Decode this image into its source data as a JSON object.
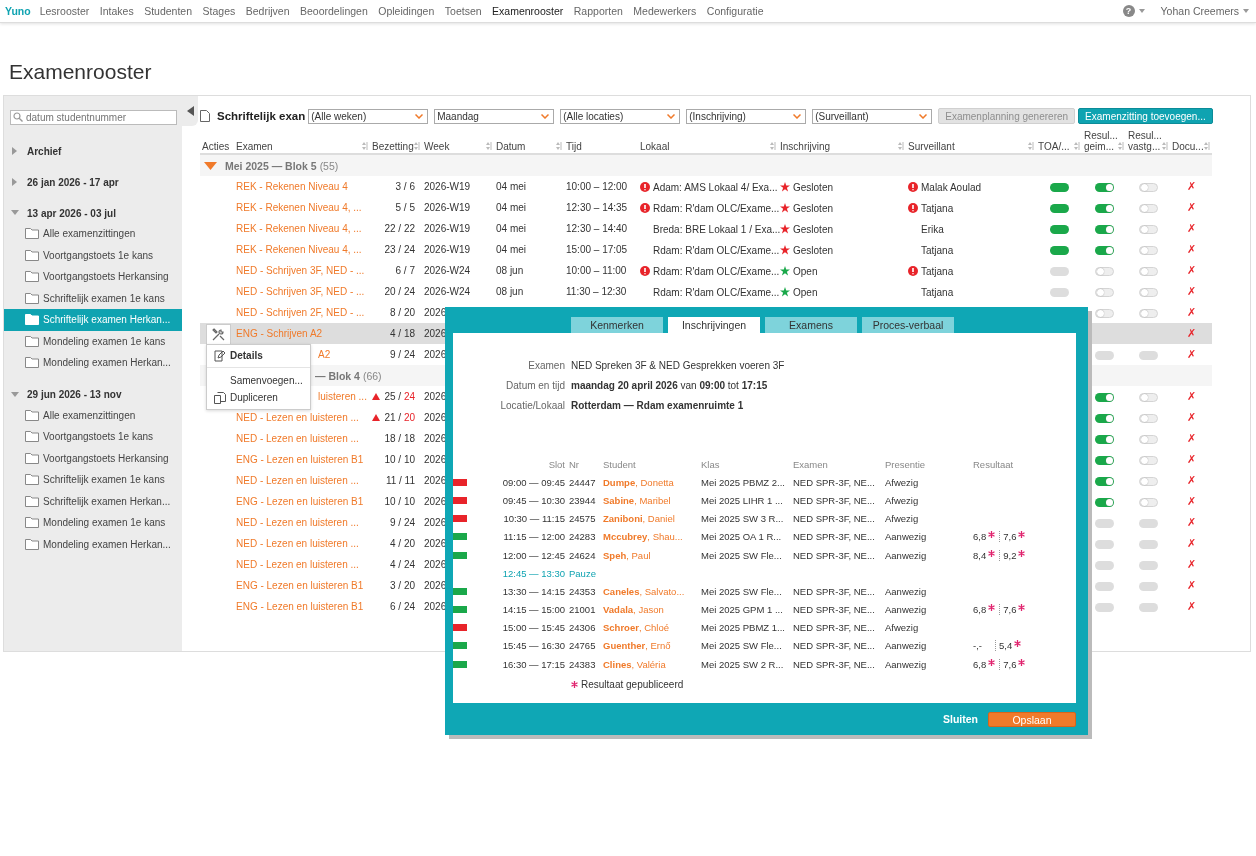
{
  "nav": {
    "logo": "Yuno",
    "items": [
      {
        "label": "Lesrooster",
        "selected": false
      },
      {
        "label": "Intakes",
        "selected": false
      },
      {
        "label": "Studenten",
        "selected": false
      },
      {
        "label": "Stages",
        "selected": false
      },
      {
        "label": "Bedrijven",
        "selected": false
      },
      {
        "label": "Beoordelingen",
        "selected": false
      },
      {
        "label": "Opleidingen",
        "selected": false
      },
      {
        "label": "Toetsen",
        "selected": false
      },
      {
        "label": "Examenrooster",
        "selected": true
      },
      {
        "label": "Rapporten",
        "selected": false
      },
      {
        "label": "Medewerkers",
        "selected": false
      },
      {
        "label": "Configuratie",
        "selected": false
      }
    ],
    "help": "?",
    "user": "Yohan Creemers"
  },
  "page_title": "Examenrooster",
  "sidebar": {
    "search_placeholder": "datum studentnummer",
    "groups": [
      {
        "label": "Archief",
        "expanded": false
      },
      {
        "label": "26 jan 2026 - 17 apr",
        "expanded": false
      },
      {
        "label": "13 apr 2026 - 03 jul",
        "expanded": true,
        "children": [
          {
            "label": "Alle examenzittingen",
            "selected": false
          },
          {
            "label": "Voortgangstoets 1e kans",
            "selected": false
          },
          {
            "label": "Voortgangstoets Herkansing",
            "selected": false
          },
          {
            "label": "Schriftelijk examen 1e kans",
            "selected": false
          },
          {
            "label": "Schriftelijk examen Herkan...",
            "selected": true
          },
          {
            "label": "Mondeling examen 1e kans",
            "selected": false
          },
          {
            "label": "Mondeling examen Herkan...",
            "selected": false
          }
        ]
      },
      {
        "label": "29 jun 2026 - 13 nov",
        "expanded": true,
        "children": [
          {
            "label": "Alle examenzittingen",
            "selected": false
          },
          {
            "label": "Voortgangstoets 1e kans",
            "selected": false
          },
          {
            "label": "Voortgangstoets Herkansing",
            "selected": false
          },
          {
            "label": "Schriftelijk examen 1e kans",
            "selected": false
          },
          {
            "label": "Schriftelijk examen Herkan...",
            "selected": false
          },
          {
            "label": "Mondeling examen 1e kans",
            "selected": false
          },
          {
            "label": "Mondeling examen Herkan...",
            "selected": false
          }
        ]
      }
    ]
  },
  "toolbar": {
    "title": "Schriftelijk exan",
    "selects": [
      {
        "value": "(Alle weken)"
      },
      {
        "value": "Maandag"
      },
      {
        "value": "(Alle locaties)"
      },
      {
        "value": "(Inschrijving)"
      },
      {
        "value": "(Surveillant)"
      }
    ],
    "buttons": [
      {
        "label": "Examenplanning genereren",
        "disabled": true
      },
      {
        "label": "Examenzitting toevoegen...",
        "disabled": false
      }
    ]
  },
  "table": {
    "columns": [
      {
        "label": "Acties",
        "sortable": false
      },
      {
        "label": "Examen",
        "sortable": true
      },
      {
        "label": "Bezetting",
        "sortable": true
      },
      {
        "label": "Week",
        "sortable": true
      },
      {
        "label": "Datum",
        "sortable": true
      },
      {
        "label": "Tijd",
        "sortable": false
      },
      {
        "label": "Lokaal",
        "sortable": true
      },
      {
        "label": "Inschrijving",
        "sortable": true
      },
      {
        "label": "Surveillant",
        "sortable": true
      },
      {
        "label": "TOA/...",
        "sortable": true
      },
      {
        "label": "geim...",
        "above": "Resul...",
        "sortable": true
      },
      {
        "label": "vastg...",
        "above": "Resul...",
        "sortable": true
      },
      {
        "label": "Docu...",
        "sortable": true
      }
    ],
    "groups": [
      {
        "label": "Mei 2025 — Blok 5",
        "count": "(55)",
        "expanded": true,
        "covered": false,
        "rows": [
          {
            "exam": "REK - Rekenen Niveau 4",
            "covered": false,
            "selected": false,
            "occupied": "3 /",
            "capacity": "6",
            "overbooked": false,
            "week": "2026-W19",
            "date": "04 mei",
            "time": "10:00 – 12:00",
            "room": "Adam: AMS Lokaal 4/ Exa...",
            "room_warning": true,
            "enrollment": "Gesloten",
            "enrollment_open": false,
            "supervisor": "Malak Aoulad",
            "supervisor_warning": true,
            "toa": true,
            "imported": true,
            "imported_disabled": false,
            "fixed": false,
            "fixed_disabled": false,
            "doc": "✗"
          },
          {
            "exam": "REK - Rekenen Niveau 4, ...",
            "covered": false,
            "selected": false,
            "occupied": "5 /",
            "capacity": "5",
            "overbooked": false,
            "week": "2026-W19",
            "date": "04 mei",
            "time": "12:30 – 14:35",
            "room": "Rdam: R'dam OLC/Exame...",
            "room_warning": true,
            "enrollment": "Gesloten",
            "enrollment_open": false,
            "supervisor": "Tatjana",
            "supervisor_warning": true,
            "toa": true,
            "imported": true,
            "imported_disabled": false,
            "fixed": false,
            "fixed_disabled": false,
            "doc": "✗"
          },
          {
            "exam": "REK - Rekenen Niveau 4, ...",
            "covered": false,
            "selected": false,
            "occupied": "22 /",
            "capacity": "22",
            "overbooked": false,
            "week": "2026-W19",
            "date": "04 mei",
            "time": "12:30 – 14:40",
            "room": "Breda: BRE Lokaal 1 / Exa...",
            "room_warning": false,
            "enrollment": "Gesloten",
            "enrollment_open": false,
            "supervisor": "Erika",
            "supervisor_warning": false,
            "toa": true,
            "imported": true,
            "imported_disabled": false,
            "fixed": false,
            "fixed_disabled": false,
            "doc": "✗"
          },
          {
            "exam": "REK - Rekenen Niveau 4, ...",
            "covered": false,
            "selected": false,
            "occupied": "23 /",
            "capacity": "24",
            "overbooked": false,
            "week": "2026-W19",
            "date": "04 mei",
            "time": "15:00 – 17:05",
            "room": "Rdam: R'dam OLC/Exame...",
            "room_warning": false,
            "enrollment": "Gesloten",
            "enrollment_open": false,
            "supervisor": "Tatjana",
            "supervisor_warning": false,
            "toa": true,
            "imported": true,
            "imported_disabled": false,
            "fixed": false,
            "fixed_disabled": false,
            "doc": "✗"
          },
          {
            "exam": "NED - Schrijven 3F, NED - ...",
            "covered": false,
            "selected": false,
            "occupied": "6 /",
            "capacity": "7",
            "overbooked": false,
            "week": "2026-W24",
            "date": "08 jun",
            "time": "10:00 – 11:00",
            "room": "Rdam: R'dam OLC/Exame...",
            "room_warning": true,
            "enrollment": "Open",
            "enrollment_open": true,
            "supervisor": "Tatjana",
            "supervisor_warning": true,
            "toa": false,
            "imported": false,
            "imported_disabled": false,
            "fixed": false,
            "fixed_disabled": false,
            "doc": "✗"
          },
          {
            "exam": "NED - Schrijven 3F, NED - ...",
            "covered": false,
            "selected": false,
            "occupied": "20 /",
            "capacity": "24",
            "overbooked": false,
            "week": "2026-W24",
            "date": "08 jun",
            "time": "11:30 – 12:30",
            "room": "Rdam: R'dam OLC/Exame...",
            "room_warning": false,
            "enrollment": "Open",
            "enrollment_open": true,
            "supervisor": "Tatjana",
            "supervisor_warning": false,
            "toa": false,
            "imported": false,
            "imported_disabled": false,
            "fixed": false,
            "fixed_disabled": false,
            "doc": "✗"
          },
          {
            "exam": "NED - Schrijven 2F, NED - ...",
            "covered": false,
            "selected": false,
            "occupied": "8 /",
            "capacity": "20",
            "overbooked": false,
            "week": "2026",
            "imported": false,
            "imported_disabled": false,
            "fixed": false,
            "fixed_disabled": false,
            "doc": "✗"
          },
          {
            "exam": "ENG - Schrijven A2",
            "covered": false,
            "selected": true,
            "occupied": "4 /",
            "capacity": "18",
            "overbooked": false,
            "week": "2026",
            "doc": "✗"
          },
          {
            "exam": "A2",
            "covered": true,
            "selected": false,
            "occupied": "9 /",
            "capacity": "24",
            "overbooked": false,
            "week": "2026",
            "imported": false,
            "imported_disabled": true,
            "fixed": false,
            "fixed_disabled": true,
            "doc": "✗"
          }
        ]
      },
      {
        "label": "— Blok 4",
        "count": "(66)",
        "covered": true,
        "rows": [
          {
            "exam": "luisteren ...",
            "covered": true,
            "selected": false,
            "occupied": "25 /",
            "capacity": "24",
            "overbooked": true,
            "week": "2026",
            "imported": true,
            "imported_disabled": false,
            "fixed": false,
            "fixed_disabled": false,
            "doc": "✗"
          },
          {
            "exam": "NED - Lezen en luisteren ...",
            "covered": false,
            "selected": false,
            "occupied": "21 /",
            "capacity": "20",
            "overbooked": true,
            "week": "2026",
            "imported": true,
            "imported_disabled": false,
            "fixed": false,
            "fixed_disabled": false,
            "doc": "✗"
          },
          {
            "exam": "NED - Lezen en luisteren ...",
            "covered": false,
            "selected": false,
            "occupied": "18 /",
            "capacity": "18",
            "overbooked": false,
            "week": "2026",
            "imported": true,
            "imported_disabled": false,
            "fixed": false,
            "fixed_disabled": false,
            "doc": "✗"
          },
          {
            "exam": "ENG - Lezen en luisteren B1",
            "covered": false,
            "selected": false,
            "occupied": "10 /",
            "capacity": "10",
            "overbooked": false,
            "week": "2026",
            "imported": true,
            "imported_disabled": false,
            "fixed": false,
            "fixed_disabled": false,
            "doc": "✗"
          },
          {
            "exam": "NED - Lezen en luisteren ...",
            "covered": false,
            "selected": false,
            "occupied": "11 /",
            "capacity": "11",
            "overbooked": false,
            "week": "2026",
            "imported": true,
            "imported_disabled": false,
            "fixed": false,
            "fixed_disabled": false,
            "doc": "✗"
          },
          {
            "exam": "ENG - Lezen en luisteren B1",
            "covered": false,
            "selected": false,
            "occupied": "10 /",
            "capacity": "10",
            "overbooked": false,
            "week": "2026",
            "imported": true,
            "imported_disabled": false,
            "fixed": false,
            "fixed_disabled": false,
            "doc": "✗"
          },
          {
            "exam": "NED - Lezen en luisteren ...",
            "covered": false,
            "selected": false,
            "occupied": "9 /",
            "capacity": "24",
            "overbooked": false,
            "week": "2026",
            "imported": false,
            "imported_disabled": true,
            "fixed": false,
            "fixed_disabled": true,
            "doc": "✗"
          },
          {
            "exam": "NED - Lezen en luisteren ...",
            "covered": false,
            "selected": false,
            "occupied": "4 /",
            "capacity": "20",
            "overbooked": false,
            "week": "2026",
            "imported": false,
            "imported_disabled": true,
            "fixed": false,
            "fixed_disabled": true,
            "doc": "✗"
          },
          {
            "exam": "NED - Lezen en luisteren ...",
            "covered": false,
            "selected": false,
            "occupied": "4 /",
            "capacity": "24",
            "overbooked": false,
            "week": "2026",
            "imported": false,
            "imported_disabled": true,
            "fixed": false,
            "fixed_disabled": true,
            "doc": "✗"
          },
          {
            "exam": "ENG - Lezen en luisteren B1",
            "covered": false,
            "selected": false,
            "occupied": "3 /",
            "capacity": "20",
            "overbooked": false,
            "week": "2026",
            "imported": false,
            "imported_disabled": true,
            "fixed": false,
            "fixed_disabled": true,
            "doc": "✗"
          },
          {
            "exam": "ENG - Lezen en luisteren B1",
            "covered": false,
            "selected": false,
            "occupied": "6 /",
            "capacity": "24",
            "overbooked": false,
            "week": "2026",
            "imported": false,
            "imported_disabled": true,
            "fixed": false,
            "fixed_disabled": true,
            "doc": "✗"
          }
        ]
      }
    ]
  },
  "context_menu": {
    "items": [
      {
        "label": "Details",
        "kind": "edit",
        "bold": true,
        "separated": false
      },
      {
        "label": "Samenvoegen...",
        "kind": "plain",
        "bold": false,
        "separated": true
      },
      {
        "label": "Dupliceren",
        "kind": "copy",
        "bold": false,
        "separated": false
      }
    ]
  },
  "dialog": {
    "tabs": [
      {
        "label": "Kenmerken",
        "selected": false
      },
      {
        "label": "Inschrijvingen",
        "selected": true
      },
      {
        "label": "Examens",
        "selected": false
      },
      {
        "label": "Proces-verbaal",
        "selected": false
      }
    ],
    "info": [
      {
        "label": "Examen",
        "value": "NED Spreken 3F & NED Gesprekken voeren 3F",
        "bold": false
      },
      {
        "label": "Datum en tijd",
        "value": "**maandag 20 april 2026** van **09:00** tot **17:15**",
        "bold": false
      },
      {
        "label": "Locatie/Lokaal",
        "value": "Rotterdam — Rdam examenruimte 1",
        "bold": true
      }
    ],
    "columns": [
      "Slot",
      "Nr",
      "Student",
      "Klas",
      "Examen",
      "Presentie",
      "Resultaat"
    ],
    "rows": [
      {
        "kind": "slot",
        "color": "#e8242a",
        "slot": "09:00 — 09:45",
        "nr": "24447",
        "student": "**Dumpe**, Donetta",
        "klas": "Mei 2025 PBMZ 2...",
        "exam": "NED SPR-3F, NE...",
        "presence": "Afwezig"
      },
      {
        "kind": "slot",
        "color": "#e8242a",
        "slot": "09:45 — 10:30",
        "nr": "23944",
        "student": "**Sabine**, Maribel",
        "klas": "Mei 2025 LIHR 1 ...",
        "exam": "NED SPR-3F, NE...",
        "presence": "Afwezig"
      },
      {
        "kind": "slot",
        "color": "#e8242a",
        "slot": "10:30 — 11:15",
        "nr": "24575",
        "student": "**Zaniboni**, Daniel",
        "klas": "Mei 2025 SW 3 R...",
        "exam": "NED SPR-3F, NE...",
        "presence": "Afwezig"
      },
      {
        "kind": "slot",
        "color": "#1aa84a",
        "slot": "11:15 — 12:00",
        "nr": "24283",
        "student": "**Mccubrey**, Shau...",
        "klas": "Mei 2025 OA 1 R...",
        "exam": "NED SPR-3F, NE...",
        "presence": "Aanwezig",
        "results": [
          {
            "value": "6,8",
            "published": true
          },
          {
            "value": "7,6",
            "published": true
          }
        ]
      },
      {
        "kind": "slot",
        "color": "#1aa84a",
        "slot": "12:00 — 12:45",
        "nr": "24624",
        "student": "**Speh**, Paul",
        "klas": "Mei 2025 SW Fle...",
        "exam": "NED SPR-3F, NE...",
        "presence": "Aanwezig",
        "results": [
          {
            "value": "8,4",
            "published": true
          },
          {
            "value": "9,2",
            "published": true
          }
        ]
      },
      {
        "kind": "pause",
        "slot": "12:45 — 13:30",
        "label": "Pauze"
      },
      {
        "kind": "slot",
        "color": "#1aa84a",
        "slot": "13:30 — 14:15",
        "nr": "24353",
        "student": "**Caneles**, Salvato...",
        "klas": "Mei 2025 SW Fle...",
        "exam": "NED SPR-3F, NE...",
        "presence": "Aanwezig"
      },
      {
        "kind": "slot",
        "color": "#1aa84a",
        "slot": "14:15 — 15:00",
        "nr": "21001",
        "student": "**Vadala**, Jason",
        "klas": "Mei 2025 GPM 1 ...",
        "exam": "NED SPR-3F, NE...",
        "presence": "Aanwezig",
        "results": [
          {
            "value": "6,8",
            "published": true
          },
          {
            "value": "7,6",
            "published": true
          }
        ]
      },
      {
        "kind": "slot",
        "color": "#e8242a",
        "slot": "15:00 — 15:45",
        "nr": "24306",
        "student": "**Schroer**, Chloé",
        "klas": "Mei 2025 PBMZ 1...",
        "exam": "NED SPR-3F, NE...",
        "presence": "Afwezig"
      },
      {
        "kind": "slot",
        "color": "#1aa84a",
        "slot": "15:45 — 16:30",
        "nr": "24765",
        "student": "**Guenther**, Ernő",
        "klas": "Mei 2025 SW Fle...",
        "exam": "NED SPR-3F, NE...",
        "presence": "Aanwezig",
        "results": [
          {
            "value": "-,-",
            "published": false
          },
          {
            "value": "5,4",
            "published": true
          }
        ]
      },
      {
        "kind": "slot",
        "color": "#1aa84a",
        "slot": "16:30 — 17:15",
        "nr": "24383",
        "student": "**Clines**, Valéria",
        "klas": "Mei 2025 SW 2 R...",
        "exam": "NED SPR-3F, NE...",
        "presence": "Aanwezig",
        "results": [
          {
            "value": "6,8",
            "published": true
          },
          {
            "value": "7,6",
            "published": true
          }
        ]
      }
    ],
    "footnote": "Resultaat gepubliceerd",
    "buttons": [
      {
        "label": "Sluiten",
        "kind": "link"
      },
      {
        "label": "Opslaan",
        "kind": "primary"
      }
    ]
  }
}
